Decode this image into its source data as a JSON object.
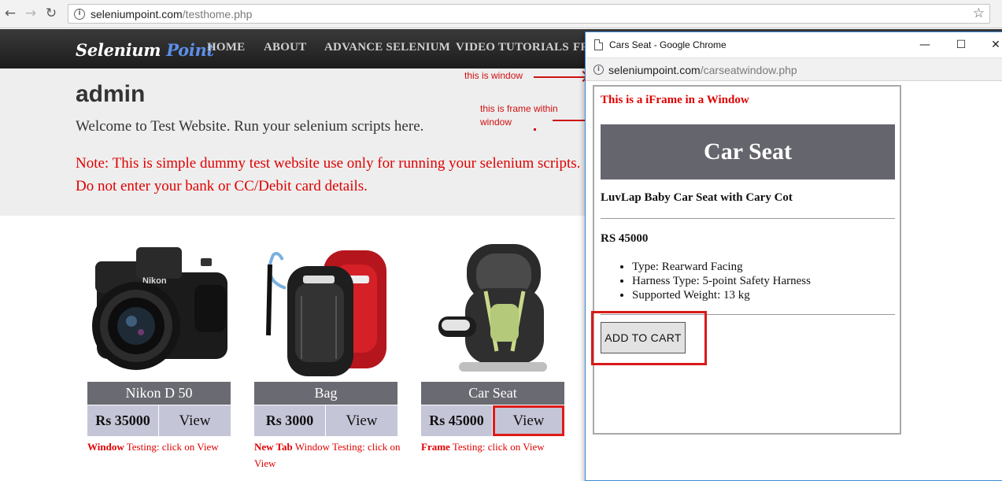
{
  "browser": {
    "url_host": "seleniumpoint.com",
    "url_path": "/testhome.php",
    "back_glyph": "←",
    "forward_glyph": "→",
    "reload_glyph": "↻",
    "star_glyph": "☆"
  },
  "site": {
    "logo_main": "Selenium",
    "logo_accent": "Point",
    "menu": [
      "HOME",
      "ABOUT",
      "ADVANCE SELENIUM",
      "VIDEO TUTORIALS",
      "FR"
    ]
  },
  "hero": {
    "title": "admin",
    "welcome": "Welcome to Test Website. Run your selenium scripts here.",
    "note": "Note: This is simple dummy test website use only for running your selenium scripts. Do not enter your bank or CC/Debit card details."
  },
  "products": [
    {
      "name": "Nikon D 50",
      "price": "Rs 35000",
      "view": "View",
      "caption_bold": "Window",
      "caption_rest": " Testing: click on View",
      "image": "camera-image"
    },
    {
      "name": "Bag",
      "price": "Rs 3000",
      "view": "View",
      "caption_bold": "New Tab",
      "caption_rest": " Window Testing: click on View",
      "image": "backpack-image"
    },
    {
      "name": "Car Seat",
      "price": "Rs 45000",
      "view": "View",
      "caption_bold": "Frame",
      "caption_rest": " Testing: click on View",
      "image": "car-seat-image"
    }
  ],
  "annotations": {
    "window": "this is window",
    "frame_line1": "this is frame within",
    "frame_line2": "window"
  },
  "popup": {
    "title": "Cars Seat - Google Chrome",
    "url_host": "seleniumpoint.com",
    "url_path": "/carseatwindow.php",
    "minimize_glyph": "—",
    "maximize_glyph": "☐",
    "close_glyph": "✕",
    "iframe": {
      "heading": "This is a iFrame in a Window",
      "banner": "Car Seat",
      "product": "LuvLap Baby Car Seat with Cary Cot",
      "price": "RS 45000",
      "features": [
        "Type: Rearward Facing",
        "Harness Type: 5-point Safety Harness",
        "Supported Weight: 13 kg"
      ],
      "add_to_cart": "ADD TO CART"
    }
  },
  "colors": {
    "annotation_red": "#d01010",
    "note_red": "#e00000",
    "product_label_bg": "#6a6a72",
    "product_button_bg": "#c5c5d8",
    "logo_accent": "#5b8fe8"
  }
}
